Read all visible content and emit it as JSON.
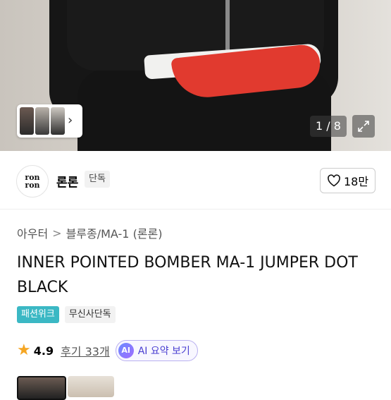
{
  "gallery": {
    "counter": "1 / 8"
  },
  "brand": {
    "logo_line1": "ron",
    "logo_line2": "ron",
    "name": "론론",
    "badge": "단독",
    "likes": "18만"
  },
  "breadcrumb": {
    "items": [
      "아우터",
      "블루종/MA-1 (론론)"
    ],
    "separator": ">"
  },
  "product": {
    "title": "INNER POINTED BOMBER MA-1 JUMPER DOT BLACK"
  },
  "tags": [
    "패션위크",
    "무신사단독"
  ],
  "rating": {
    "score": "4.9",
    "reviews": "후기 33개",
    "ai_label": "AI 요약 보기",
    "ai_badge": "AI"
  },
  "colors": {
    "tag_accent": "#3bb8c4",
    "star": "#f5a623",
    "ai_accent": "#4a3fd1"
  }
}
